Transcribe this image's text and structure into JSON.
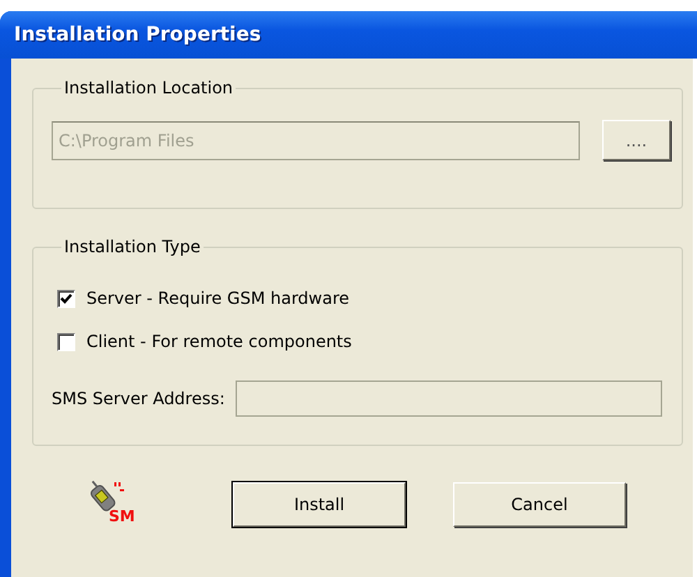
{
  "window": {
    "title": "Installation Properties"
  },
  "location_group": {
    "title": "Installation Location",
    "path_field": {
      "value": "C:\\Program Files",
      "disabled": true
    },
    "browse_button": "...."
  },
  "type_group": {
    "title": "Installation Type",
    "options": [
      {
        "label": "Server - Require GSM hardware",
        "checked": true
      },
      {
        "label": "Client - For remote components",
        "checked": false
      }
    ],
    "address_label": "SMS Server Address:"
  },
  "logo_text": "SM",
  "buttons": [
    {
      "label": "Install",
      "default": true
    },
    {
      "label": "Cancel",
      "default": false
    }
  ]
}
